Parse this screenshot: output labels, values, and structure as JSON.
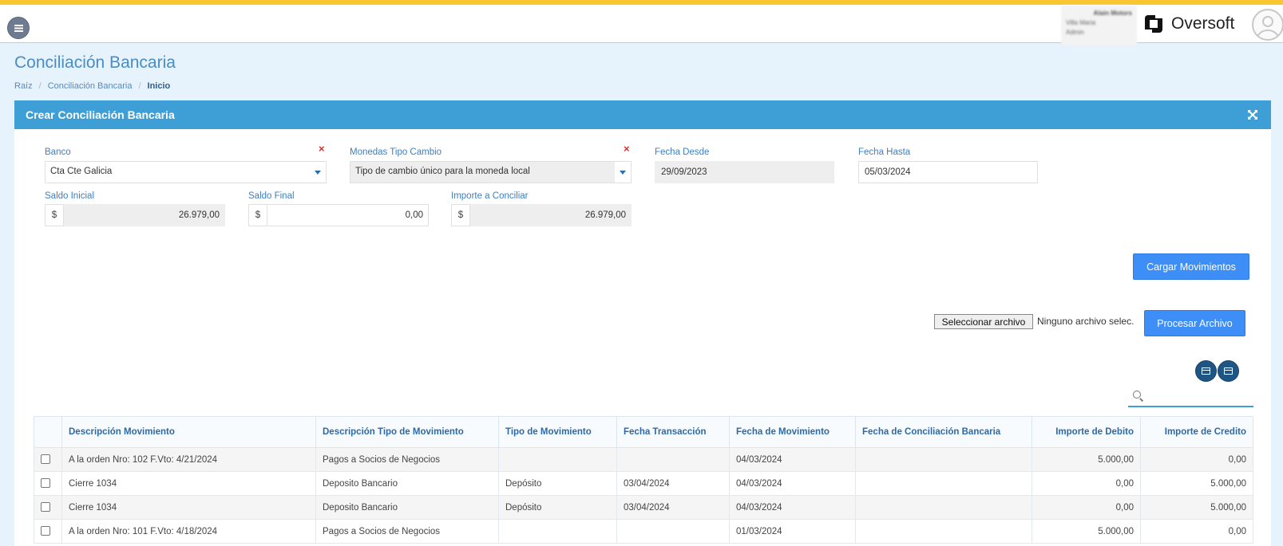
{
  "header": {
    "user": {
      "name": "Alain Motors",
      "line2": "Villa Maria",
      "line3": "Admin"
    },
    "brand": "Oversoft"
  },
  "page": {
    "title": "Conciliación Bancaria",
    "breadcrumb": [
      "Raíz",
      "Conciliación Bancaria",
      "Inicio"
    ],
    "breadcrumb_sep": "/"
  },
  "panel": {
    "title": "Crear Conciliación Bancaria"
  },
  "form": {
    "banco": {
      "label": "Banco",
      "value": "Cta Cte Galicia",
      "clear": "×"
    },
    "monedas": {
      "label": "Monedas Tipo Cambio",
      "value": "Tipo de cambio único para la moneda local",
      "clear": "×"
    },
    "fecha_desde": {
      "label": "Fecha Desde",
      "value": "29/09/2023"
    },
    "fecha_hasta": {
      "label": "Fecha Hasta",
      "value": "05/03/2024"
    },
    "saldo_inicial": {
      "label": "Saldo Inicial",
      "currency": "$",
      "value": "26.979,00"
    },
    "saldo_final": {
      "label": "Saldo Final",
      "currency": "$",
      "value": "0,00"
    },
    "importe_conciliar": {
      "label": "Importe a Conciliar",
      "currency": "$",
      "value": "26.979,00"
    }
  },
  "actions": {
    "cargar": "Cargar Movimientos",
    "seleccionar": "Seleccionar archivo",
    "archivo_status": "Ninguno archivo selec.",
    "procesar": "Procesar Archivo"
  },
  "search": {
    "placeholder": ""
  },
  "table": {
    "columns": [
      "Descripción Movimiento",
      "Descripción Tipo de Movimiento",
      "Tipo de Movimiento",
      "Fecha Transacción",
      "Fecha de Movimiento",
      "Fecha de Conciliación Bancaria",
      "Importe de Debito",
      "Importe de Credito"
    ],
    "rows": [
      [
        "A la orden Nro: 102 F.Vto: 4/21/2024",
        "Pagos a Socios de Negocios",
        "",
        "",
        "04/03/2024",
        "",
        "5.000,00",
        "0,00"
      ],
      [
        "Cierre 1034",
        "Deposito Bancario",
        "Depósito",
        "03/04/2024",
        "04/03/2024",
        "",
        "0,00",
        "5.000,00"
      ],
      [
        "Cierre 1034",
        "Deposito Bancario",
        "Depósito",
        "03/04/2024",
        "04/03/2024",
        "",
        "0,00",
        "5.000,00"
      ],
      [
        "A la orden Nro: 101 F.Vto: 4/18/2024",
        "Pagos a Socios de Negocios",
        "",
        "",
        "01/03/2024",
        "",
        "5.000,00",
        "0,00"
      ]
    ]
  },
  "colors": {
    "accent_bar": "#f7c630",
    "panel_header": "#3d9fd6",
    "button_primary": "#3e8ef7",
    "label_blue": "#3d7fbf",
    "clear_red": "#d82b2b"
  }
}
